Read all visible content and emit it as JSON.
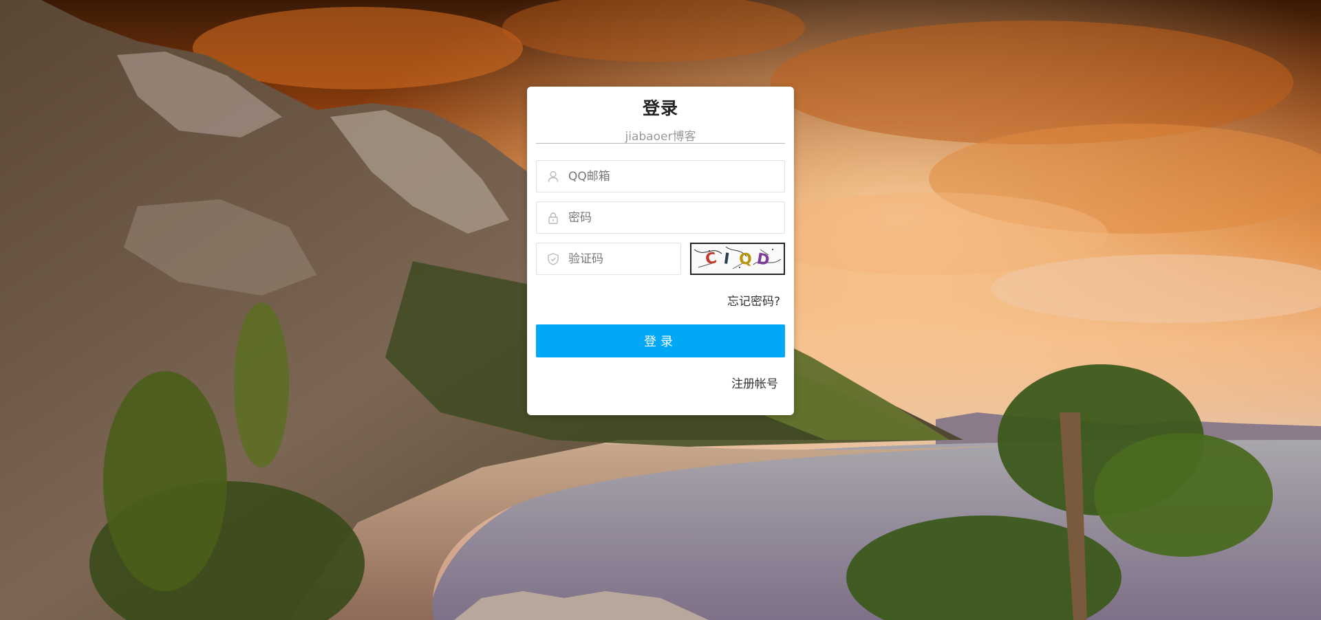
{
  "login": {
    "title": "登录",
    "subtitle": "jiabaoer博客",
    "email_placeholder": "QQ邮箱",
    "password_placeholder": "密码",
    "captcha_placeholder": "验证码",
    "captcha_text": "CIQD",
    "forgot_label": "忘记密码?",
    "submit_label": "登录",
    "register_label": "注册帐号"
  },
  "icons": {
    "email_field": "user-icon",
    "password_field": "lock-icon",
    "captcha_field": "shield-check-icon"
  },
  "colors": {
    "primary_button": "#00a8f6",
    "card_background": "#ffffff",
    "sky": "#d9741f"
  }
}
